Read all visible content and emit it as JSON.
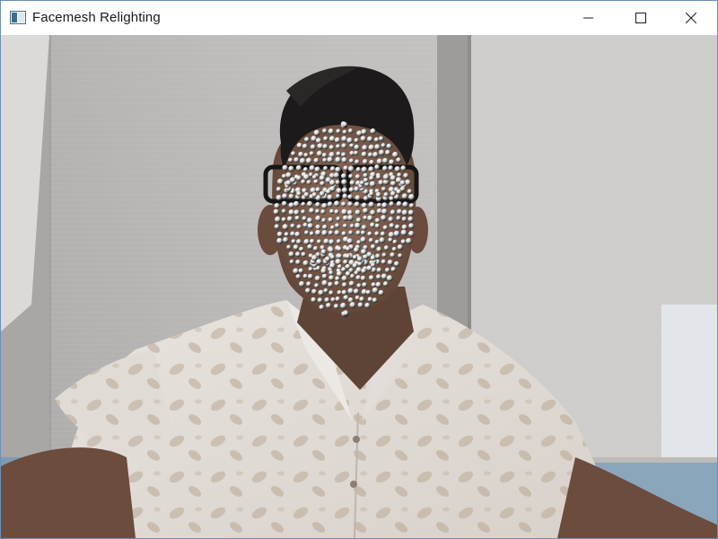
{
  "window": {
    "title": "Facemesh Relighting",
    "icon": "app-window-icon",
    "controls": {
      "minimize": "minimize-icon",
      "maximize": "maximize-icon",
      "close": "close-icon"
    }
  },
  "video": {
    "content": "webcam-feed-with-face-landmarks",
    "landmark_style": "white spheres with dark shading",
    "colors": {
      "wall": "#b4b2b0",
      "blind": "#c9c7c5",
      "shirt": "#e7e2dd",
      "skin": "#8a6a58",
      "hair": "#1c1a1a",
      "sofa": "#8aa6bb"
    }
  }
}
